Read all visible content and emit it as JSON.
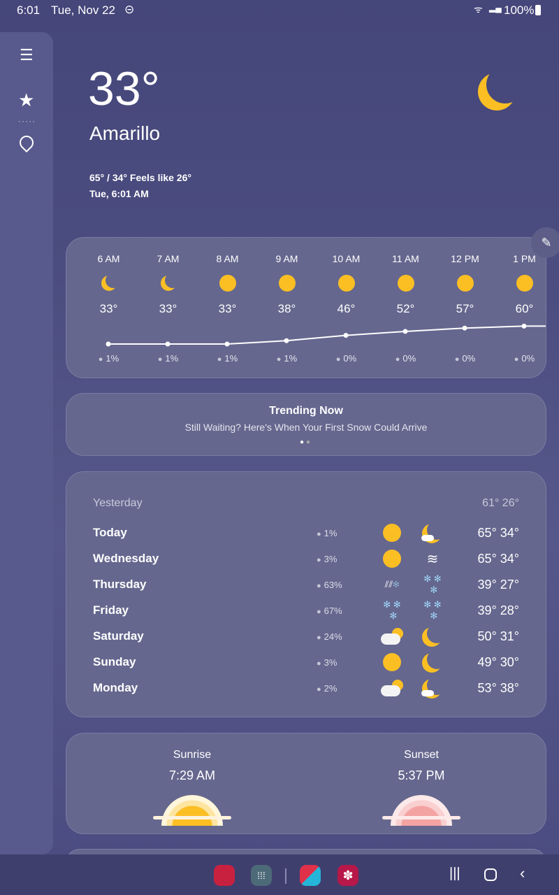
{
  "status": {
    "time": "6:01",
    "date": "Tue, Nov 22",
    "battery": "100%"
  },
  "sidebar": {
    "icons": [
      "menu-icon",
      "star-icon",
      "add-location-icon"
    ]
  },
  "current": {
    "temp": "33°",
    "city": "Amarillo",
    "hilo_feels": "65° / 34° Feels like 26°",
    "updated": "Tue, 6:01 AM",
    "icon": "moon"
  },
  "hourly": [
    {
      "time": "6 AM",
      "icon": "moon",
      "temp": "33°",
      "t": 33,
      "precip": "1%"
    },
    {
      "time": "7 AM",
      "icon": "moon",
      "temp": "33°",
      "t": 33,
      "precip": "1%"
    },
    {
      "time": "8 AM",
      "icon": "sun",
      "temp": "33°",
      "t": 33,
      "precip": "1%"
    },
    {
      "time": "9 AM",
      "icon": "sun",
      "temp": "38°",
      "t": 38,
      "precip": "1%"
    },
    {
      "time": "10 AM",
      "icon": "sun",
      "temp": "46°",
      "t": 46,
      "precip": "0%"
    },
    {
      "time": "11 AM",
      "icon": "sun",
      "temp": "52°",
      "t": 52,
      "precip": "0%"
    },
    {
      "time": "12 PM",
      "icon": "sun",
      "temp": "57°",
      "t": 57,
      "precip": "0%"
    },
    {
      "time": "1 PM",
      "icon": "sun",
      "temp": "60°",
      "t": 60,
      "precip": "0%"
    }
  ],
  "trending": {
    "title": "Trending Now",
    "text": "Still Waiting? Here's When Your First Snow Could Arrive",
    "pages": 2,
    "active_page": 1
  },
  "daily": {
    "yesterday": {
      "label": "Yesterday",
      "temps": "61° 26°"
    },
    "days": [
      {
        "day": "Today",
        "precip": "1%",
        "day_icon": "sun",
        "night_icon": "moon-cloud",
        "temps": "65° 34°"
      },
      {
        "day": "Wednesday",
        "precip": "3%",
        "day_icon": "sun",
        "night_icon": "wind",
        "temps": "65° 34°"
      },
      {
        "day": "Thursday",
        "precip": "63%",
        "day_icon": "sleet",
        "night_icon": "snow",
        "temps": "39° 27°"
      },
      {
        "day": "Friday",
        "precip": "67%",
        "day_icon": "snow",
        "night_icon": "snow",
        "temps": "39° 28°"
      },
      {
        "day": "Saturday",
        "precip": "24%",
        "day_icon": "partly-cloudy",
        "night_icon": "moon",
        "temps": "50° 31°"
      },
      {
        "day": "Sunday",
        "precip": "3%",
        "day_icon": "sun",
        "night_icon": "moon",
        "temps": "49° 30°"
      },
      {
        "day": "Monday",
        "precip": "2%",
        "day_icon": "partly-cloudy",
        "night_icon": "moon-cloud",
        "temps": "53° 38°"
      }
    ]
  },
  "sun": {
    "sunrise_label": "Sunrise",
    "sunrise": "7:29 AM",
    "sunset_label": "Sunset",
    "sunset": "5:37 PM"
  },
  "colors": {
    "accent": "#fbbf24",
    "snow": "#9fd3f5"
  }
}
